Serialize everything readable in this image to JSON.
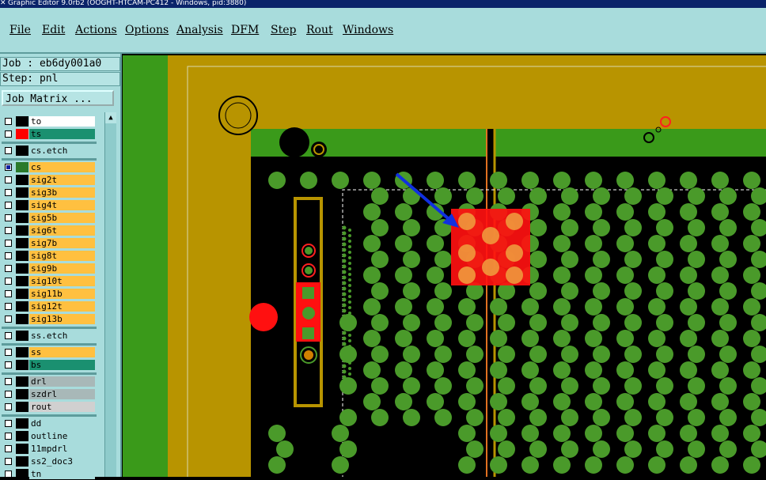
{
  "window": {
    "title": "Graphic Editor 9.0rb2 (OOGHT-HTCAM-PC412 - Windows, pid:3880)"
  },
  "menu": [
    "File",
    "Edit",
    "Actions",
    "Options",
    "Analysis",
    "DFM",
    "Step",
    "Rout",
    "Windows"
  ],
  "job": {
    "label": "Job : eb6dy001a0",
    "step": "Step: pnl"
  },
  "job_matrix_button": "Job Matrix ...",
  "layers": [
    {
      "name": "to",
      "color": "#ffffff",
      "swatch": "#000000",
      "checked": false
    },
    {
      "name": "ts",
      "color": "#1a9070",
      "swatch": "#ff0000",
      "checked": false
    },
    {
      "name": "cs.etch",
      "color": "#a8dcdc",
      "swatch": "#000000",
      "checked": false
    },
    {
      "name": "cs",
      "color": "#ffc040",
      "swatch": "#2a7a2a",
      "checked": true
    },
    {
      "name": "sig2t",
      "color": "#ffc040",
      "swatch": "#000000",
      "checked": false
    },
    {
      "name": "sig3b",
      "color": "#ffc040",
      "swatch": "#000000",
      "checked": false
    },
    {
      "name": "sig4t",
      "color": "#ffc040",
      "swatch": "#000000",
      "checked": false
    },
    {
      "name": "sig5b",
      "color": "#ffc040",
      "swatch": "#000000",
      "checked": false
    },
    {
      "name": "sig6t",
      "color": "#ffc040",
      "swatch": "#000000",
      "checked": false
    },
    {
      "name": "sig7b",
      "color": "#ffc040",
      "swatch": "#000000",
      "checked": false
    },
    {
      "name": "sig8t",
      "color": "#ffc040",
      "swatch": "#000000",
      "checked": false
    },
    {
      "name": "sig9b",
      "color": "#ffc040",
      "swatch": "#000000",
      "checked": false
    },
    {
      "name": "sig10t",
      "color": "#ffc040",
      "swatch": "#000000",
      "checked": false
    },
    {
      "name": "sig11b",
      "color": "#ffc040",
      "swatch": "#000000",
      "checked": false
    },
    {
      "name": "sig12t",
      "color": "#ffc040",
      "swatch": "#000000",
      "checked": false
    },
    {
      "name": "sig13b",
      "color": "#ffc040",
      "swatch": "#000000",
      "checked": false
    },
    {
      "name": "ss.etch",
      "color": "#a8dcdc",
      "swatch": "#000000",
      "checked": false
    },
    {
      "name": "ss",
      "color": "#ffc040",
      "swatch": "#000000",
      "checked": false
    },
    {
      "name": "bs",
      "color": "#1a9070",
      "swatch": "#000000",
      "checked": false
    },
    {
      "name": "drl",
      "color": "#a8b8b8",
      "swatch": "#000000",
      "checked": false
    },
    {
      "name": "szdrl",
      "color": "#a8b8b8",
      "swatch": "#000000",
      "checked": false
    },
    {
      "name": "rout",
      "color": "#d0d0d0",
      "swatch": "#000000",
      "checked": false
    },
    {
      "name": "dd",
      "color": "#a8dcdc",
      "swatch": "#000000",
      "checked": false
    },
    {
      "name": "outline",
      "color": "#a8dcdc",
      "swatch": "#000000",
      "checked": false
    },
    {
      "name": "11mpdrl",
      "color": "#a8dcdc",
      "swatch": "#000000",
      "checked": false
    },
    {
      "name": "ss2_doc3",
      "color": "#a8dcdc",
      "swatch": "#000000",
      "checked": false
    },
    {
      "name": "tn",
      "color": "#a8dcdc",
      "swatch": "#000000",
      "checked": false
    }
  ],
  "colors": {
    "copper": "#b89400",
    "board_green": "#3a9a1a",
    "pad_green": "#4a9a2a",
    "highlight": "#ff1010",
    "arrow": "#1030e0"
  }
}
